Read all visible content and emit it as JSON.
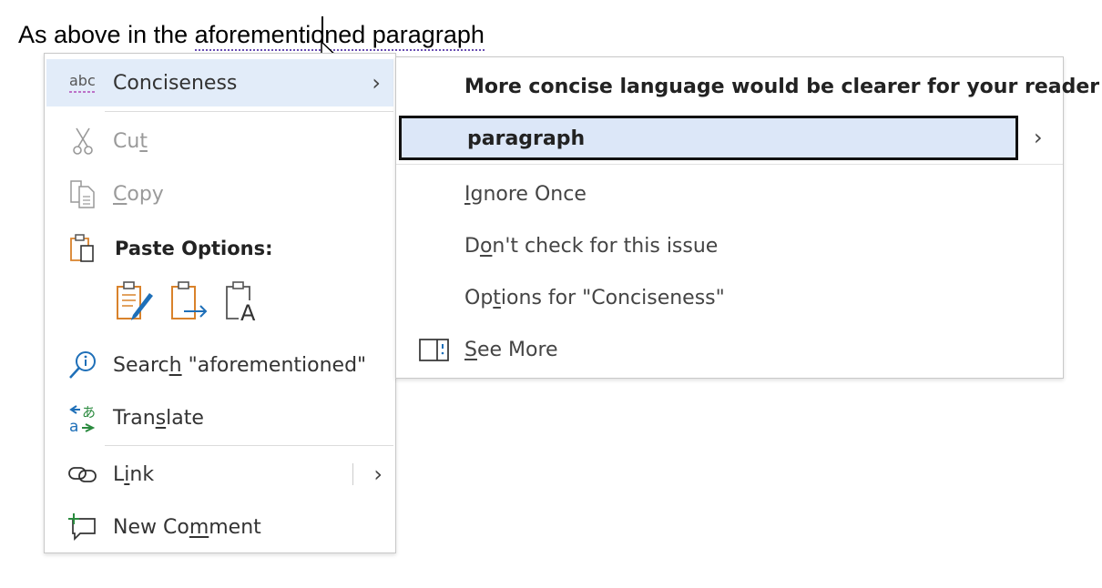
{
  "document": {
    "text_before": "As above in the ",
    "flagged_text": "aforementioned paragraph"
  },
  "context_menu": {
    "conciseness": {
      "icon": "abc-spelling-icon",
      "label": "Conciseness"
    },
    "cut": {
      "icon": "scissors-icon",
      "pre": "Cu",
      "acc": "t",
      "post": ""
    },
    "copy": {
      "icon": "copy-icon",
      "pre": "",
      "acc": "C",
      "post": "opy"
    },
    "paste_options": {
      "icon": "clipboard-icon",
      "label": "Paste Options:"
    },
    "paste_buttons": [
      "keep-source-formatting-icon",
      "merge-formatting-icon",
      "keep-text-only-icon"
    ],
    "search": {
      "icon": "search-info-icon",
      "pre": "Searc",
      "acc": "h",
      "post": " \"aforementioned\""
    },
    "translate": {
      "icon": "translate-icon",
      "pre": "Tran",
      "acc": "s",
      "post": "late"
    },
    "link": {
      "icon": "link-icon",
      "pre": "L",
      "acc": "i",
      "post": "nk"
    },
    "new_comment": {
      "icon": "new-comment-icon",
      "pre": "New Co",
      "acc": "m",
      "post": "ment"
    }
  },
  "submenu": {
    "title": "More concise language would be clearer for your reader",
    "suggestion": "paragraph",
    "ignore_once": {
      "pre": "",
      "acc": "I",
      "post": "gnore Once"
    },
    "dont_check": {
      "pre": "D",
      "acc": "o",
      "post": "n't check for this issue"
    },
    "options": {
      "pre": "Op",
      "acc": "t",
      "post": "ions for \"Conciseness\""
    },
    "see_more": {
      "icon": "pane-icon",
      "pre": "",
      "acc": "S",
      "post": "ee More"
    }
  },
  "colors": {
    "accent": "#e2ecf9",
    "icon_blue": "#1e6fb8",
    "icon_orange": "#d9822b"
  }
}
